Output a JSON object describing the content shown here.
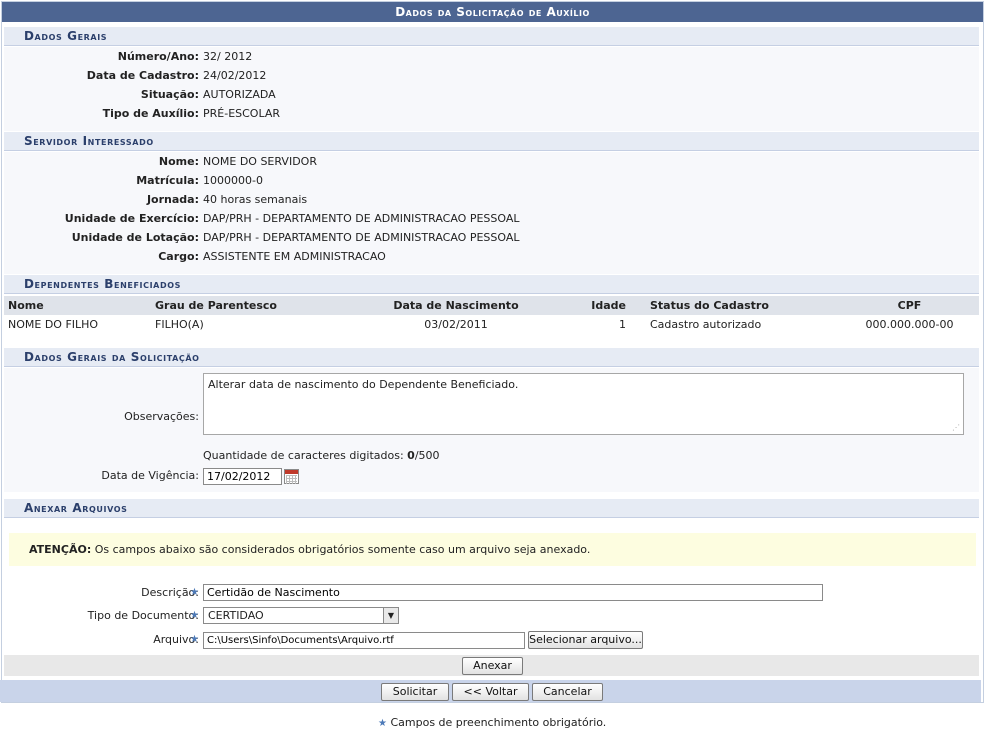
{
  "title": "Dados da Solicitação de Auxílio",
  "dados_gerais": {
    "heading": "Dados Gerais",
    "fields": [
      {
        "label": "Número/Ano:",
        "value": "32/ 2012"
      },
      {
        "label": "Data de Cadastro:",
        "value": "24/02/2012"
      },
      {
        "label": "Situação:",
        "value": "AUTORIZADA"
      },
      {
        "label": "Tipo de Auxílio:",
        "value": "PRÉ-ESCOLAR"
      }
    ]
  },
  "servidor": {
    "heading": "Servidor Interessado",
    "fields": [
      {
        "label": "Nome:",
        "value": "NOME DO SERVIDOR"
      },
      {
        "label": "Matrícula:",
        "value": "1000000-0"
      },
      {
        "label": "Jornada:",
        "value": "40 horas semanais"
      },
      {
        "label": "Unidade de Exercício:",
        "value": "DAP/PRH - DEPARTAMENTO DE ADMINISTRACAO PESSOAL"
      },
      {
        "label": "Unidade de Lotação:",
        "value": "DAP/PRH - DEPARTAMENTO DE ADMINISTRACAO PESSOAL"
      },
      {
        "label": "Cargo:",
        "value": "ASSISTENTE EM ADMINISTRACAO"
      }
    ]
  },
  "dependentes": {
    "heading": "Dependentes Beneficiados",
    "columns": [
      "Nome",
      "Grau de Parentesco",
      "Data de Nascimento",
      "Idade",
      "Status do Cadastro",
      "CPF"
    ],
    "rows": [
      [
        "NOME DO FILHO",
        "FILHO(A)",
        "03/02/2011",
        "1",
        "Cadastro autorizado",
        "000.000.000-00"
      ]
    ]
  },
  "solicitacao": {
    "heading": "Dados Gerais da Solicitação",
    "observacoes_label": "Observações:",
    "observacoes_value": "Alterar data de nascimento do Dependente Beneficiado.",
    "char_count_prefix": "Quantidade de caracteres digitados:",
    "char_count": "0",
    "char_max": "/500",
    "vigencia_label": "Data de Vigência:",
    "vigencia_value": "17/02/2012"
  },
  "anexar": {
    "heading": "Anexar Arquivos",
    "attention_label": "ATENÇÃO:",
    "attention_text": "Os campos abaixo são considerados obrigatórios somente caso um arquivo seja anexado.",
    "descricao_label": "Descrição:",
    "descricao_value": "Certidão de Nascimento",
    "tipo_label": "Tipo de Documento:",
    "tipo_value": "CERTIDAO",
    "arquivo_label": "Arquivo:",
    "arquivo_value": "C:\\Users\\Sinfo\\Documents\\Arquivo.rtf",
    "selecionar_label": "Selecionar arquivo...",
    "anexar_label": "Anexar"
  },
  "actions": {
    "solicitar": "Solicitar",
    "voltar": "<< Voltar",
    "cancelar": "Cancelar"
  },
  "legend_text": "Campos de preenchimento obrigatório.",
  "colors": {
    "caption_bg": "#4d6592",
    "section_bg": "#e6ebf4",
    "required_star": "#4d7ab8",
    "attention_bg": "#fdfde0"
  }
}
